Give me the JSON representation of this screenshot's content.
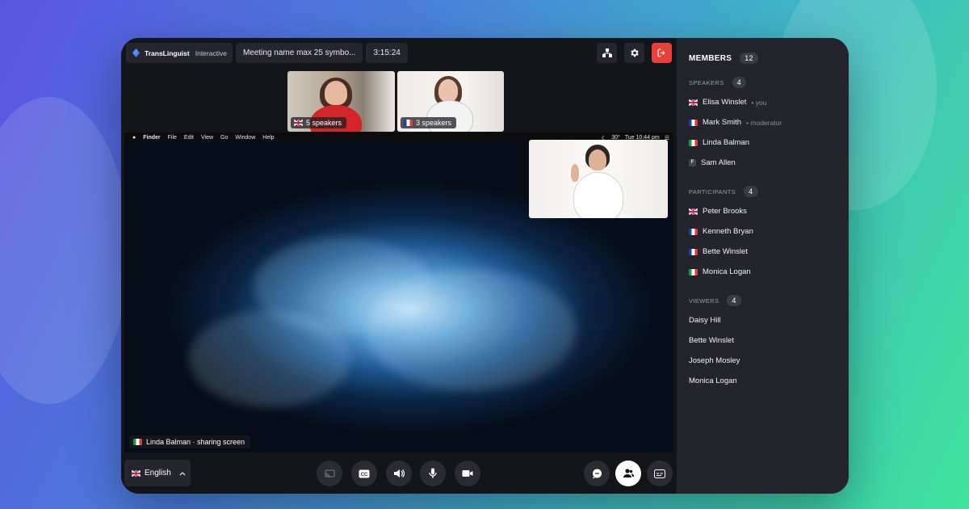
{
  "app": {
    "brand": "TransLinguist",
    "brand_suffix": "Interactive",
    "meeting_name": "Meeting name max 25 symbo...",
    "timer": "3:15:24"
  },
  "toolbar": {
    "share_icon": "org-chart-icon",
    "settings_icon": "gear-icon",
    "leave_icon": "exit-icon",
    "leave_color": "#e8413a"
  },
  "thumbnails": [
    {
      "label": "5 speakers",
      "flag": "uk"
    },
    {
      "label": "3 speakers",
      "flag": "fr"
    }
  ],
  "screen": {
    "menubar": {
      "apple": "",
      "items": [
        "Finder",
        "File",
        "Edit",
        "View",
        "Go",
        "Window",
        "Help"
      ],
      "right": [
        "30°",
        "Tue 10:44 pm"
      ]
    },
    "presenter_label": "Linda Balman · sharing screen"
  },
  "controls": {
    "language": "English",
    "buttons": [
      "cast-icon",
      "cc-icon",
      "speaker-icon",
      "microphone-icon",
      "camera-icon"
    ],
    "right_buttons": [
      "chat-icon",
      "members-icon",
      "subtitles-icon"
    ]
  },
  "sidebar": {
    "title": "MEMBERS",
    "total": "12",
    "sections": [
      {
        "name": "SPEAKERS",
        "count": "4",
        "members": [
          {
            "name": "Elisa Winslet",
            "role": "• you",
            "flag": "uk"
          },
          {
            "name": "Mark Smith",
            "role": "• moderator",
            "flag": "fr"
          },
          {
            "name": "Linda Balman",
            "role": "",
            "flag": "it"
          },
          {
            "name": "Sam Allen",
            "role": "",
            "flag": "f"
          }
        ]
      },
      {
        "name": "PARTICIPANTS",
        "count": "4",
        "members": [
          {
            "name": "Peter Brooks",
            "role": "",
            "flag": "uk"
          },
          {
            "name": "Kenneth Bryan",
            "role": "",
            "flag": "fr"
          },
          {
            "name": "Bette Winslet",
            "role": "",
            "flag": "fr"
          },
          {
            "name": "Monica Logan",
            "role": "",
            "flag": "it"
          }
        ]
      },
      {
        "name": "VIEWERS",
        "count": "4",
        "members": [
          {
            "name": "Daisy Hill",
            "role": "",
            "flag": ""
          },
          {
            "name": "Bette Winslet",
            "role": "",
            "flag": ""
          },
          {
            "name": "Joseph Mosley",
            "role": "",
            "flag": ""
          },
          {
            "name": "Monica Logan",
            "role": "",
            "flag": ""
          }
        ]
      }
    ]
  }
}
